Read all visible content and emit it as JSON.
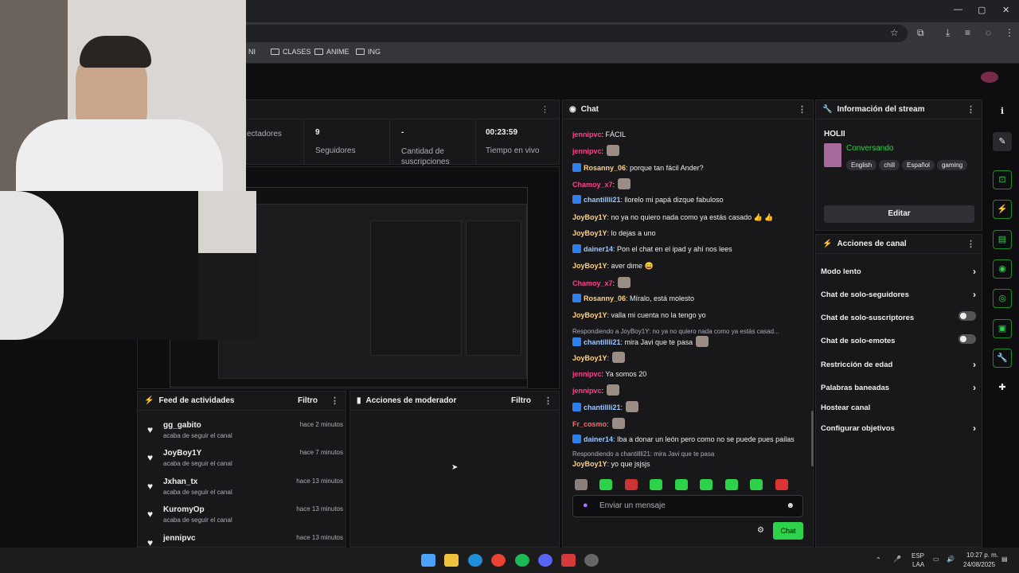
{
  "browser": {
    "bookmarks": [
      {
        "label": "NI"
      },
      {
        "label": "CLASES"
      },
      {
        "label": "ANIME"
      },
      {
        "label": "ING"
      }
    ],
    "window_controls": [
      "—",
      "▢",
      "✕"
    ]
  },
  "stats": [
    {
      "value": "",
      "label": "ectadores"
    },
    {
      "value": "9",
      "label": "Seguidores"
    },
    {
      "value": "-",
      "label": "Cantidad de suscripciones"
    },
    {
      "value": "00:23:59",
      "label": "Tiempo en vivo"
    }
  ],
  "feed": {
    "title": "Feed de actividades",
    "filter": "Filtro",
    "items": [
      {
        "name": "gg_gabito",
        "action": "acaba de seguir el canal",
        "time": "hace 2 minutos"
      },
      {
        "name": "JoyBoy1Y",
        "action": "acaba de seguir el canal",
        "time": "hace 7 minutos"
      },
      {
        "name": "Jxhan_tx",
        "action": "acaba de seguir el canal",
        "time": "hace 13 minutos"
      },
      {
        "name": "KuromyOp",
        "action": "acaba de seguir el canal",
        "time": "hace 13 minutos"
      },
      {
        "name": "jennipvc",
        "action": "",
        "time": "hace 13 minutos"
      }
    ]
  },
  "mod": {
    "title": "Acciones de moderador",
    "filter": "Filtro"
  },
  "chat": {
    "title": "Chat",
    "messages": [
      {
        "user": "jennipvc",
        "text": ": FÁCIL",
        "color": "pink",
        "badge": false
      },
      {
        "user": "jennipvc",
        "text": ":",
        "color": "pink",
        "badge": false,
        "emote": true
      },
      {
        "user": "Rosanny_06",
        "text": ": porque tan fácil Ander?",
        "color": "gold",
        "badge": true
      },
      {
        "user": "Chamoy_x7",
        "text": ":",
        "color": "pink",
        "badge": false,
        "emote": true
      },
      {
        "user": "chantillli21",
        "text": ": llorelo mi papá dizque fabuloso",
        "color": "blue",
        "badge": true
      },
      {
        "user": "JoyBoy1Y",
        "text": ": no ya no quiero nada como ya estás casado 👍 👍",
        "color": "gold",
        "badge": false
      },
      {
        "user": "JoyBoy1Y",
        "text": ": lo dejas a uno",
        "color": "gold",
        "badge": false
      },
      {
        "user": "dainer14",
        "text": ": Pon el chat en el ipad y ahí nos lees",
        "color": "blue",
        "badge": true
      },
      {
        "user": "JoyBoy1Y",
        "text": ": aver dime 😄",
        "color": "gold",
        "badge": false
      },
      {
        "user": "Chamoy_x7",
        "text": ":",
        "color": "pink",
        "badge": false,
        "emote": true
      },
      {
        "user": "Rosanny_06",
        "text": ": Míralo, está molesto",
        "color": "gold",
        "badge": true
      },
      {
        "user": "JoyBoy1Y",
        "text": ": valla mi cuenta no la tengo yo",
        "color": "gold",
        "badge": false
      },
      {
        "reply": "Respondiendo a JoyBoy1Y: no ya no quiero nada como ya estás casad..."
      },
      {
        "user": "chantillli21",
        "text": ": mira Javi que te pasa",
        "color": "blue",
        "badge": true,
        "emote": true
      },
      {
        "user": "JoyBoy1Y",
        "text": ":",
        "color": "gold",
        "badge": false,
        "emote": true
      },
      {
        "user": "jennipvc",
        "text": ": Ya somos 20",
        "color": "pink",
        "badge": false
      },
      {
        "user": "jennipvc",
        "text": ":",
        "color": "pink",
        "badge": false,
        "emote": true
      },
      {
        "user": "chantillli21",
        "text": ":",
        "color": "blue",
        "badge": true,
        "emote": true
      },
      {
        "user": "Fr_cosmo",
        "text": ":",
        "color": "red",
        "badge": false,
        "emote": true
      },
      {
        "user": "dainer14",
        "text": ": Iba a donar un león pero como no se puede pues pailas",
        "color": "blue",
        "badge": true
      },
      {
        "reply": "Respondiendo a chantillli21: mira Javi que te pasa"
      },
      {
        "user": "JoyBoy1Y",
        "text": ": yo que jsjsjs",
        "color": "gold",
        "badge": false
      }
    ],
    "input_placeholder": "Enviar un mensaje",
    "send_label": "Chat"
  },
  "stream_info": {
    "title": "Información del stream",
    "stream_title": "HOLII",
    "category": "Conversando",
    "tags": [
      "English",
      "chill",
      "Español",
      "gaming"
    ],
    "edit_label": "Editar"
  },
  "channel_actions": {
    "title": "Acciones de canal",
    "items": [
      {
        "label": "Modo lento",
        "kind": "chevron"
      },
      {
        "label": "Chat de solo-seguidores",
        "kind": "chevron"
      },
      {
        "label": "Chat de solo-suscriptores",
        "kind": "toggle"
      },
      {
        "label": "Chat de solo-emotes",
        "kind": "toggle"
      },
      {
        "label": "Restricción de edad",
        "kind": "chevron"
      },
      {
        "label": "Palabras baneadas",
        "kind": "chevron"
      },
      {
        "label": "Hostear canal",
        "kind": "none"
      },
      {
        "label": "Configurar objetivos",
        "kind": "chevron"
      }
    ]
  },
  "taskbar": {
    "lang": "ESP",
    "lang2": "LAA",
    "time": "10:27 p. m.",
    "date": "24/08/2025"
  },
  "colors": {
    "accent": "#2bd24a",
    "bg": "#0e0e10",
    "panel": "#18181b"
  }
}
